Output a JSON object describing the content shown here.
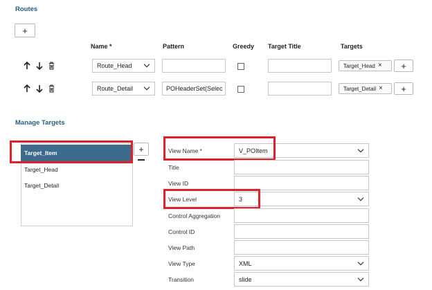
{
  "routes": {
    "title": "Routes",
    "add_label": "+",
    "headers": {
      "name": "Name *",
      "pattern": "Pattern",
      "greedy": "Greedy",
      "target_title": "Target Title",
      "targets": "Targets"
    },
    "rows": [
      {
        "name": "Route_Head",
        "pattern": "",
        "target_title": "",
        "target_token": "Target_Head",
        "add_label": "+"
      },
      {
        "name": "Route_Detail",
        "pattern": "POHeaderSet(Selec",
        "target_title": "",
        "target_token": "Target_Detail",
        "add_label": "+"
      }
    ]
  },
  "manage_targets": {
    "title": "Manage Targets",
    "add_label": "+",
    "items": [
      "Target_Item",
      "Target_Head",
      "Target_Detail"
    ],
    "selected_index": 0
  },
  "form": {
    "view_name": {
      "label": "View Name *",
      "value": "V_POItem"
    },
    "title": {
      "label": "Title",
      "value": ""
    },
    "view_id": {
      "label": "View ID",
      "value": ""
    },
    "view_level": {
      "label": "View Level",
      "value": "3"
    },
    "control_aggregation": {
      "label": "Control Aggregation",
      "value": ""
    },
    "control_id": {
      "label": "Control ID",
      "value": ""
    },
    "view_path": {
      "label": "View Path",
      "value": ""
    },
    "view_type": {
      "label": "View Type",
      "value": "XML"
    },
    "transition": {
      "label": "Transition",
      "value": "slide"
    }
  },
  "colors": {
    "accent": "#2a5d86",
    "highlight": "#e0202a",
    "selected_bg": "#3d6b8e"
  }
}
